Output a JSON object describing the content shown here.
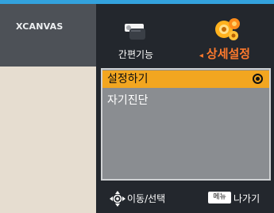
{
  "brand": {
    "name": "XCANVAS"
  },
  "tabs": {
    "simple": {
      "label": "간편기능",
      "icon": "remote-control-icon"
    },
    "detail": {
      "label": "상세설정",
      "icon": "gears-icon",
      "arrow": "◂"
    }
  },
  "menu": {
    "items": [
      {
        "label": "설정하기",
        "selected": true
      },
      {
        "label": "자기진단",
        "selected": false
      }
    ]
  },
  "footer": {
    "nav_label": "이동/선택",
    "nav_icon": "dpad-icon",
    "menu_key_label": "메뉴",
    "exit_label": "나가기"
  },
  "colors": {
    "accent_blue": "#33a2dd",
    "accent_orange": "#ff7a2d",
    "selection": "#f2a620"
  }
}
